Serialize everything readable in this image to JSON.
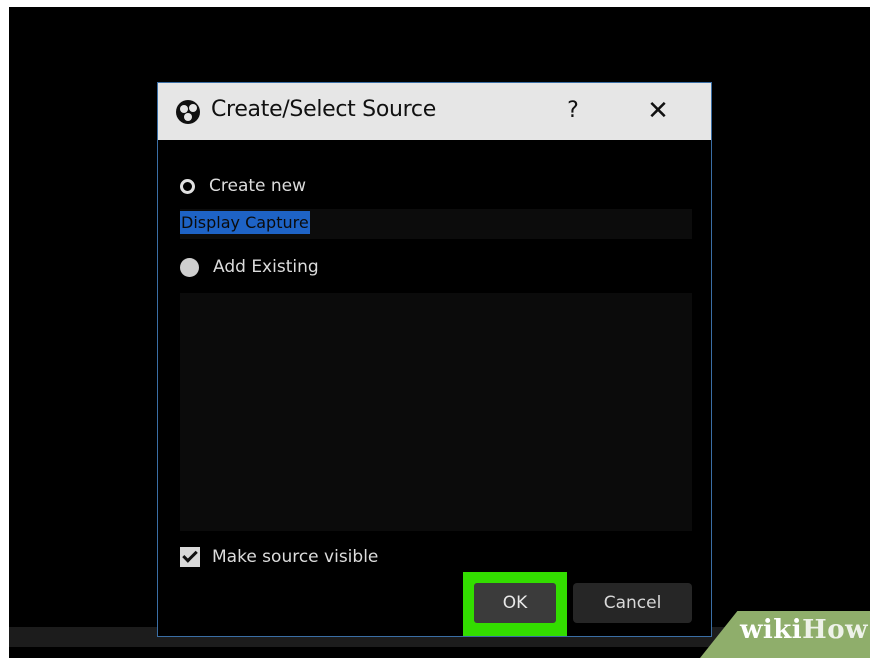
{
  "dialog": {
    "title": "Create/Select Source",
    "help_label": "?",
    "close_label": "✕",
    "create_new_label": "Create new",
    "source_name_value": "Display Capture",
    "add_existing_label": "Add Existing",
    "make_visible_label": "Make source visible",
    "ok_label": "OK",
    "cancel_label": "Cancel",
    "icons": [
      "obs-logo-icon",
      "radio-empty-icon",
      "radio-filled-icon",
      "checkbox-checked-icon"
    ],
    "colors": {
      "highlight": "#33dd00",
      "selection": "#1e63c6",
      "accent_border": "#3a6ea5"
    }
  },
  "watermark": {
    "wiki": "wiki",
    "how": "How"
  }
}
